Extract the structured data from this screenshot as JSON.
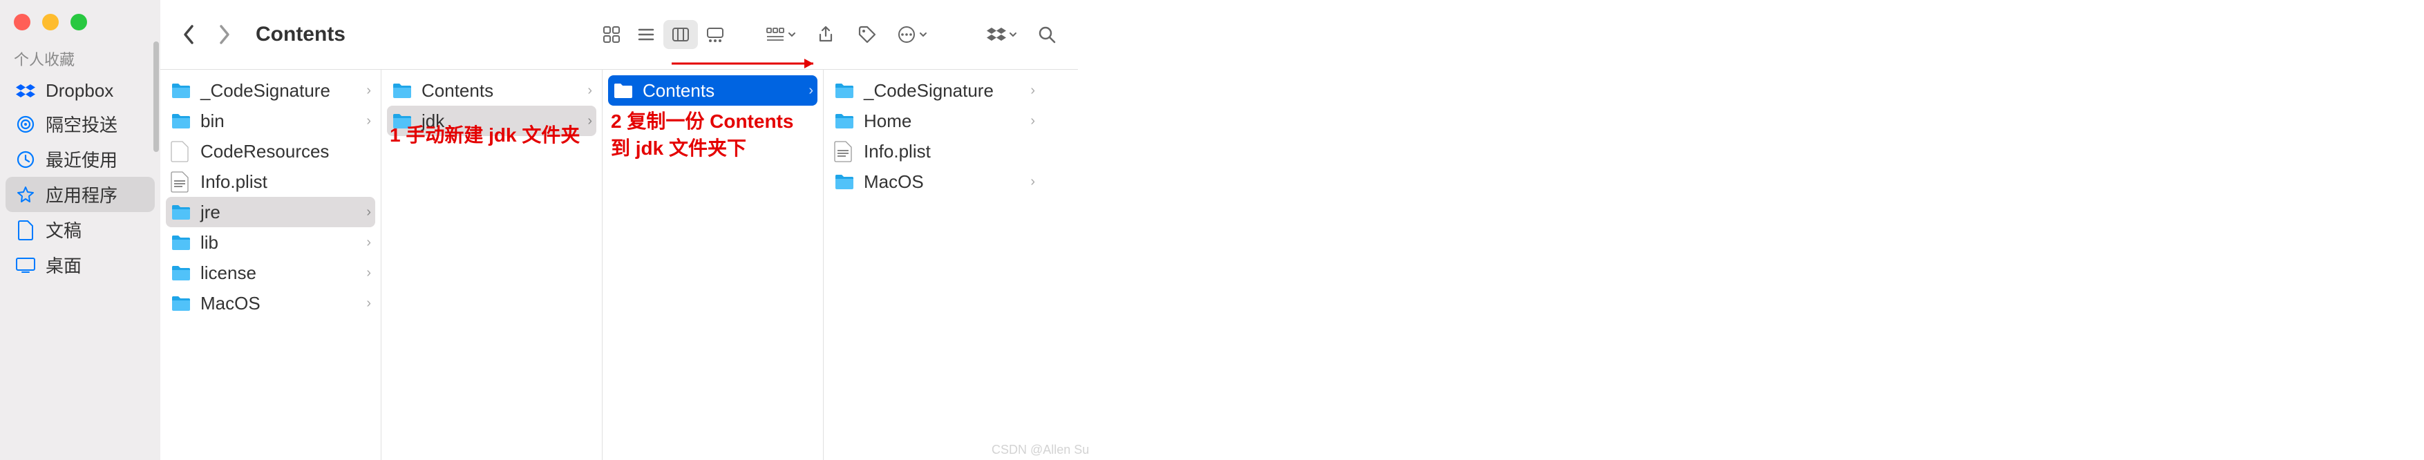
{
  "window": {
    "title": "Contents"
  },
  "sidebar": {
    "section_label": "个人收藏",
    "items": [
      {
        "label": "Dropbox",
        "icon": "dropbox",
        "color": "#0061ff"
      },
      {
        "label": "隔空投送",
        "icon": "airdrop",
        "color": "#007aff"
      },
      {
        "label": "最近使用",
        "icon": "clock",
        "color": "#007aff"
      },
      {
        "label": "应用程序",
        "icon": "app",
        "color": "#007aff",
        "selected": true
      },
      {
        "label": "文稿",
        "icon": "doc",
        "color": "#007aff"
      },
      {
        "label": "桌面",
        "icon": "desktop",
        "color": "#007aff"
      }
    ]
  },
  "columns": [
    {
      "items": [
        {
          "name": "_CodeSignature",
          "type": "folder",
          "hasChildren": true
        },
        {
          "name": "bin",
          "type": "folder",
          "hasChildren": true
        },
        {
          "name": "CodeResources",
          "type": "file"
        },
        {
          "name": "Info.plist",
          "type": "plist"
        },
        {
          "name": "jre",
          "type": "folder",
          "hasChildren": true,
          "selected": "gray"
        },
        {
          "name": "lib",
          "type": "folder",
          "hasChildren": true
        },
        {
          "name": "license",
          "type": "folder",
          "hasChildren": true
        },
        {
          "name": "MacOS",
          "type": "folder",
          "hasChildren": true
        }
      ]
    },
    {
      "items": [
        {
          "name": "Contents",
          "type": "folder",
          "hasChildren": true
        },
        {
          "name": "jdk",
          "type": "folder",
          "hasChildren": true,
          "selected": "gray"
        }
      ],
      "annotation": "1 手动新建 jdk 文件夹"
    },
    {
      "items": [
        {
          "name": "Contents",
          "type": "folder",
          "hasChildren": true,
          "selected": "blue"
        }
      ],
      "annotation": "2 复制一份 Contents 到 jdk 文件夹下"
    },
    {
      "items": [
        {
          "name": "_CodeSignature",
          "type": "folder",
          "hasChildren": true
        },
        {
          "name": "Home",
          "type": "folder",
          "hasChildren": true
        },
        {
          "name": "Info.plist",
          "type": "plist"
        },
        {
          "name": "MacOS",
          "type": "folder",
          "hasChildren": true
        }
      ]
    }
  ],
  "watermark": "CSDN @Allen Su"
}
